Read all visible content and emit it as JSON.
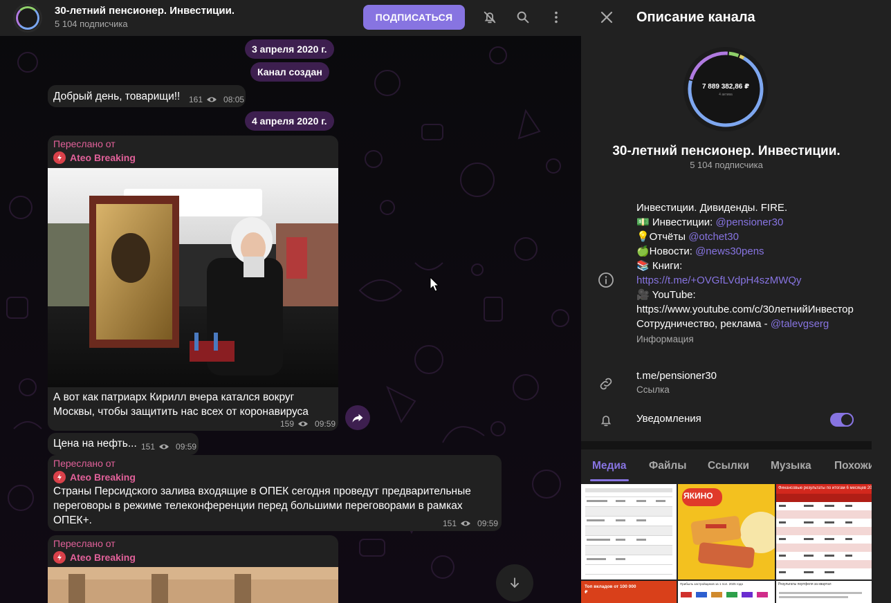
{
  "chat": {
    "title": "30-летний пенсионер. Инвестиции.",
    "subscribers": "5 104 подписчика",
    "subscribe_label": "ПОДПИСАТЬСЯ",
    "dates": [
      "3 апреля 2020 г.",
      "4 апреля 2020 г."
    ],
    "service": "Канал создан",
    "messages": [
      {
        "text": "Добрый день, товарищи!!",
        "views": "161",
        "time": "08:05"
      },
      {
        "fwd_label": "Переслано от",
        "fwd_name": "Ateo Breaking",
        "text": "А вот как патриарх Кирилл вчера катался вокруг Москвы, чтобы защитить нас всех от коронавируса",
        "views": "159",
        "time": "09:59"
      },
      {
        "text": "Цена на нефть...",
        "views": "151",
        "time": "09:59"
      },
      {
        "fwd_label": "Переслано от",
        "fwd_name": "Ateo Breaking",
        "text": "Страны Персидского залива входящие в ОПЕК сегодня проведут предварительные переговоры в режиме телеконференции перед большими переговорами в рамках ОПЕК+.",
        "views": "151",
        "time": "09:59"
      },
      {
        "fwd_label": "Переслано от",
        "fwd_name": "Ateo Breaking"
      }
    ]
  },
  "info": {
    "header_title": "Описание канала",
    "avatar_amount": "7 889 382,86 ₽",
    "avatar_sub": "4 актива",
    "name": "30-летний пенсионер. Инвестиции.",
    "subscribers": "5 104 подписчика",
    "description": {
      "line1": "Инвестиции. Дивиденды. FIRE.",
      "inv_prefix": "💵 Инвестиции: ",
      "inv_link": "@pensioner30",
      "rep_prefix": "💡Отчёты ",
      "rep_link": "@otchet30",
      "news_prefix": "🍏Новости: ",
      "news_link": "@news30pens",
      "books_prefix": "📚 Книги:",
      "books_link": "https://t.me/+OVGfLVdpH4szMWQy",
      "yt_prefix": "🎥 YouTube:",
      "yt_url": "https://www.youtube.com/c/30летнийИнвестор",
      "coop_prefix": "Сотрудничество, реклама - ",
      "coop_link": "@talevgserg"
    },
    "desc_caption": "Информация",
    "link_value": "t.me/pensioner30",
    "link_caption": "Ссылка",
    "notifications_label": "Уведомления",
    "notifications_on": true,
    "tabs": [
      "Медиа",
      "Файлы",
      "Ссылки",
      "Музыка",
      "Похожи"
    ],
    "media_thumb_texts": {
      "t3_head": "Финансовые результаты по итогам 6 месяцев 2025 года",
      "t4_head": "Топ вкладов от 100 000 ₽",
      "t5_head": "Прибыль застройщиков за 1 пол. 2025 года",
      "t6_head": "Результаты портфеля за квартал",
      "t2_brand": "ЯКИНО"
    }
  },
  "colors": {
    "accent": "#8774e1",
    "forward": "#e2619a",
    "date_pill": "#3d1f4f",
    "bubble": "#212121",
    "panel": "#212121"
  }
}
